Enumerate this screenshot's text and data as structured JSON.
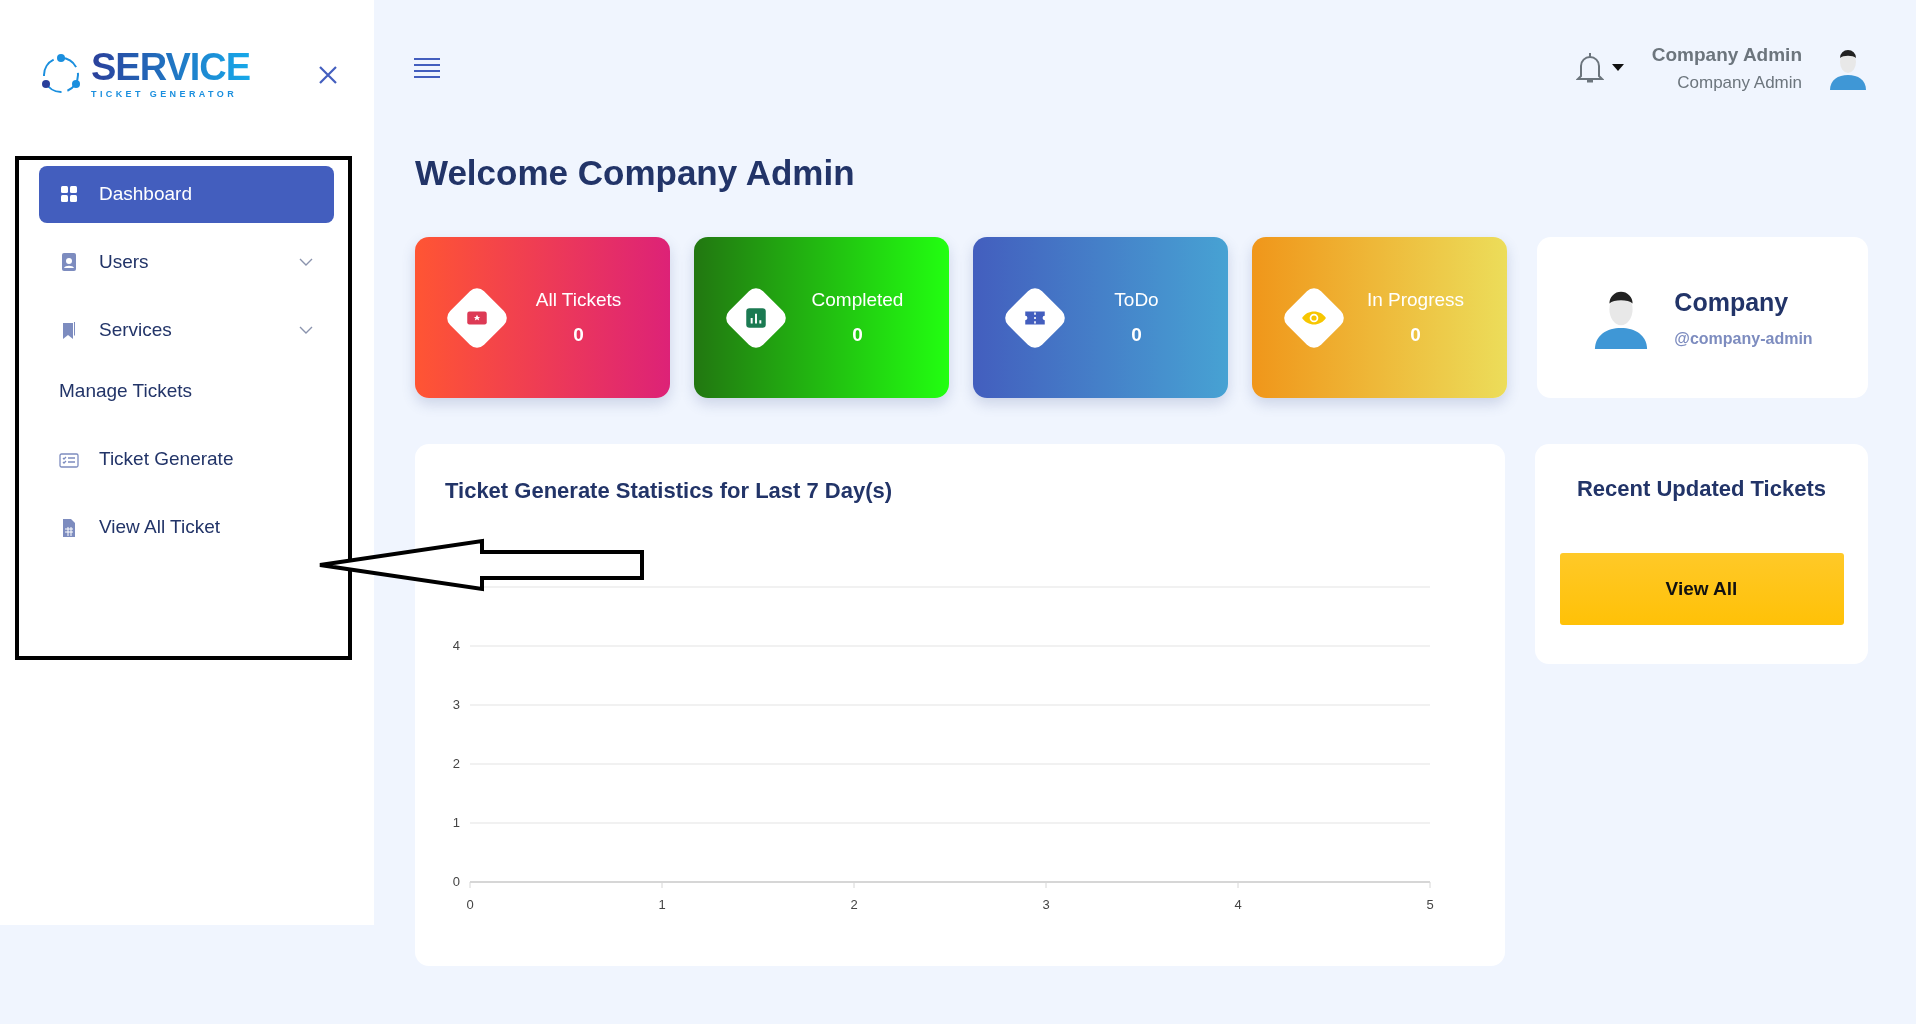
{
  "sidebar": {
    "logo": {
      "title": "SERVICE",
      "subtitle": "TICKET GENERATOR"
    },
    "items": [
      {
        "kind": "link",
        "label": "Dashboard",
        "selected": true
      },
      {
        "kind": "dropdown",
        "label": "Users",
        "selected": false
      },
      {
        "kind": "dropdown",
        "label": "Services",
        "selected": false
      },
      {
        "kind": "heading",
        "label": "Manage Tickets",
        "selected": false
      },
      {
        "kind": "link",
        "label": "Ticket Generate",
        "selected": false
      },
      {
        "kind": "link",
        "label": "View All Ticket",
        "selected": false
      }
    ]
  },
  "topbar": {
    "user_name": "Company Admin",
    "user_role": "Company Admin"
  },
  "welcome": "Welcome Company Admin",
  "stats": [
    {
      "kind": "all",
      "label": "All Tickets",
      "value": "0"
    },
    {
      "kind": "completed",
      "label": "Completed",
      "value": "0"
    },
    {
      "kind": "todo",
      "label": "ToDo",
      "value": "0"
    },
    {
      "kind": "progress",
      "label": "In Progress",
      "value": "0"
    }
  ],
  "profile": {
    "name": "Company",
    "handle": "@company-admin"
  },
  "statistics": {
    "title": "Ticket Generate Statistics for Last 7 Day(s)",
    "chart_data": {
      "type": "line",
      "grid": true,
      "xlim": [
        0,
        5
      ],
      "ylim": [
        0,
        5
      ],
      "xticks": [
        0,
        1,
        2,
        3,
        4,
        5
      ],
      "yticks": [
        0,
        1,
        2,
        3,
        4
      ]
    }
  },
  "recent": {
    "title": "Recent Updated Tickets",
    "button": "View All"
  }
}
